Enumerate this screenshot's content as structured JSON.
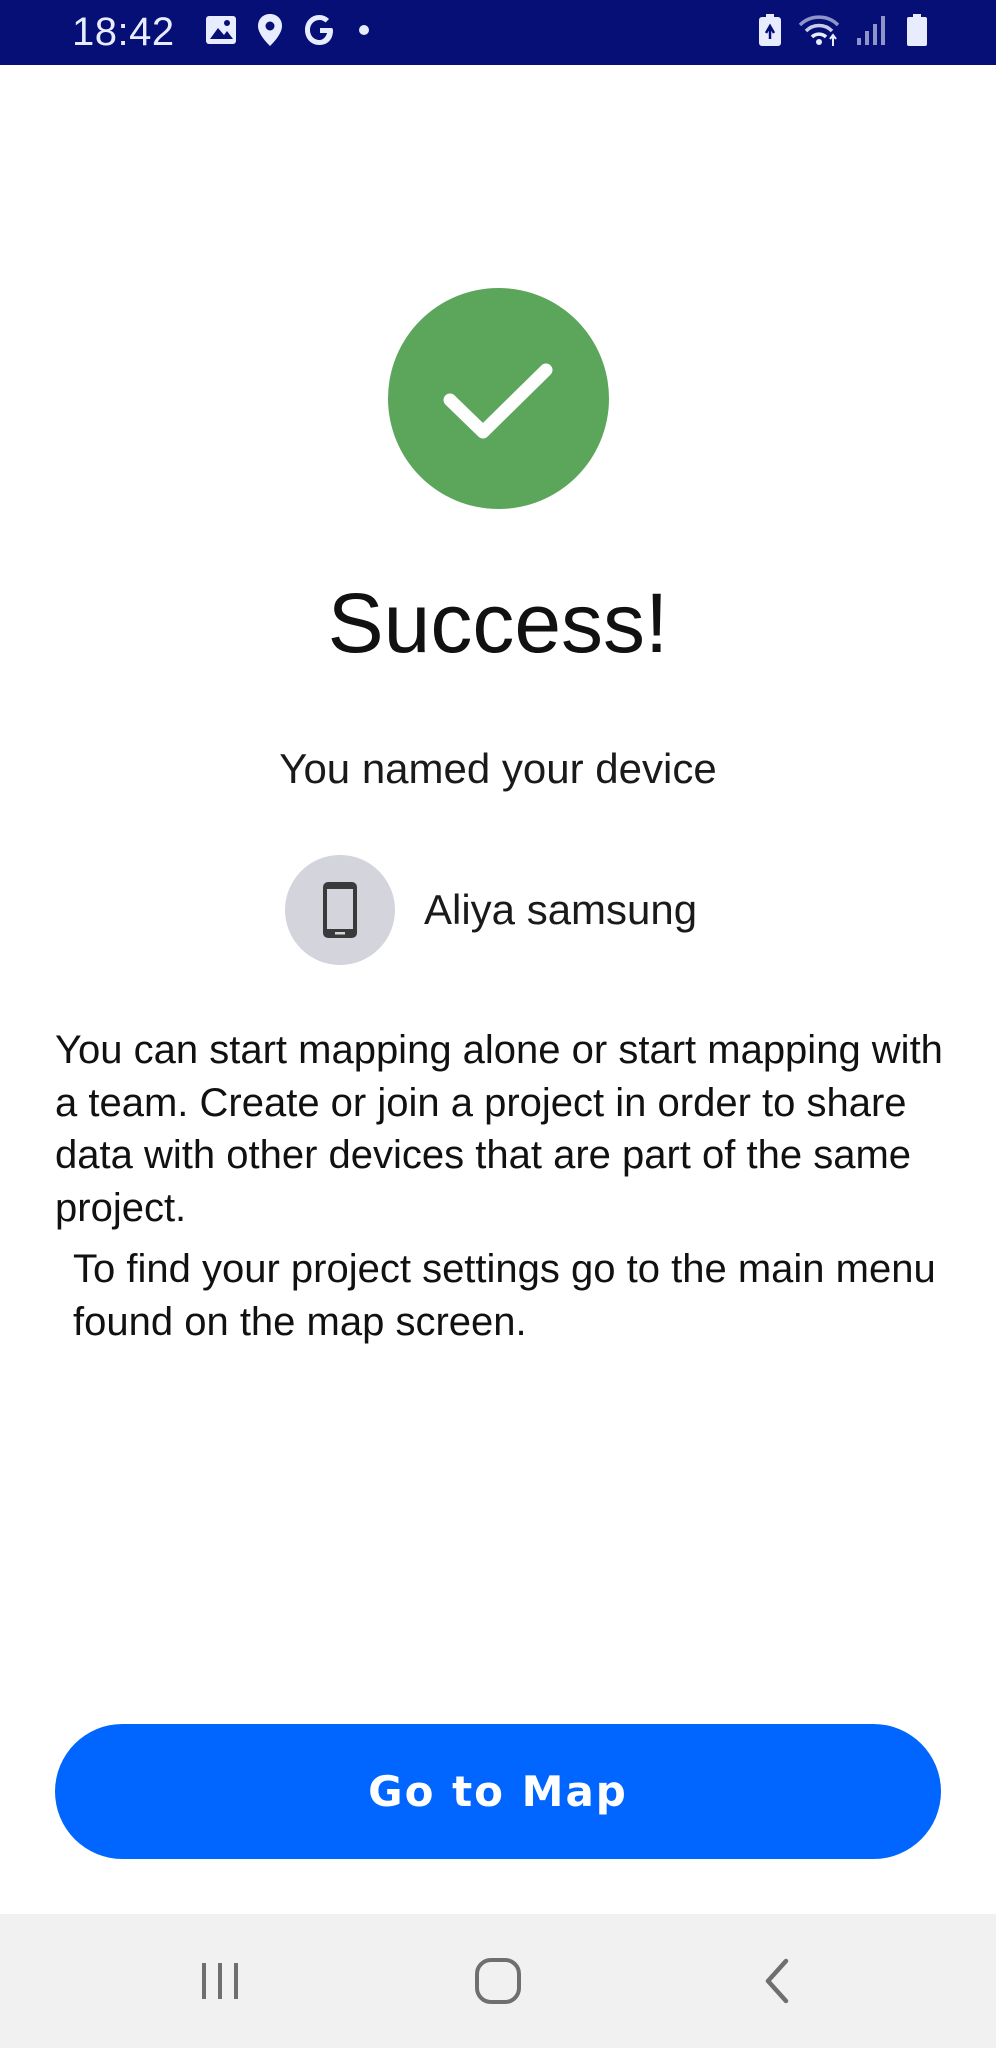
{
  "status_bar": {
    "time": "18:42",
    "left_icons": [
      "image-icon",
      "location-pin-icon",
      "google-g-icon",
      "dot-icon"
    ],
    "right_icons": [
      "battery-saver-icon",
      "wifi-icon",
      "signal-icon",
      "battery-icon"
    ],
    "background": "#060f75"
  },
  "main": {
    "status_icon": "checkmark-icon",
    "status_color": "#5ba65a",
    "title": "Success!",
    "subtitle": "You named your device",
    "device": {
      "icon": "phone-icon",
      "name": "Aliya samsung"
    },
    "paragraph_1": "You can start mapping alone or start mapping with a team. Create or join a project in order to share data with other devices that are part of the same project.",
    "paragraph_2": "To find your project settings go to the main menu found on the map screen."
  },
  "actions": {
    "go_to_map_label": "Go to Map",
    "button_color": "#0066ff"
  },
  "nav_bar": {
    "items": [
      "recent-apps-icon",
      "home-icon",
      "back-icon"
    ]
  }
}
